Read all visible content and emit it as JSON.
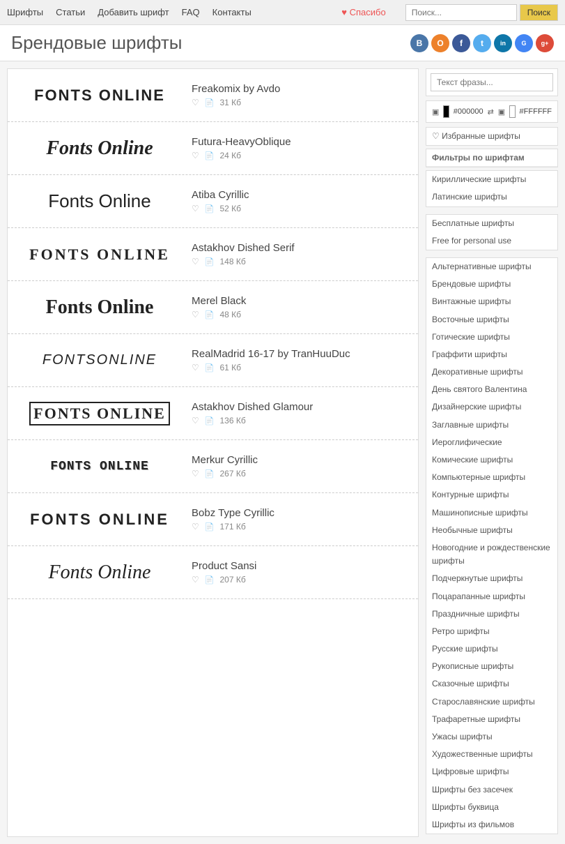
{
  "nav": {
    "links": [
      {
        "label": "Шрифты",
        "id": "nav-fonts"
      },
      {
        "label": "Статьи",
        "id": "nav-articles"
      },
      {
        "label": "Добавить шрифт",
        "id": "nav-add"
      },
      {
        "label": "FAQ",
        "id": "nav-faq"
      },
      {
        "label": "Контакты",
        "id": "nav-contacts"
      }
    ],
    "thanks": "♥ Спасибо",
    "search_placeholder": "Поиск...",
    "search_button": "Поиск"
  },
  "header": {
    "title": "Брендовые шрифты"
  },
  "social": [
    {
      "label": "В",
      "color": "#4a76a8",
      "id": "vk"
    },
    {
      "label": "О",
      "color": "#ed812b",
      "id": "ok"
    },
    {
      "label": "f",
      "color": "#3b5998",
      "id": "fb"
    },
    {
      "label": "t",
      "color": "#55acee",
      "id": "tw"
    },
    {
      "label": "in",
      "color": "#0e76a8",
      "id": "li"
    },
    {
      "label": "🔵",
      "color": "#4285f4",
      "id": "g1"
    },
    {
      "label": "g+",
      "color": "#dd4b39",
      "id": "gp"
    }
  ],
  "sidebar": {
    "phrase_placeholder": "Текст фразы...",
    "color_dark": "#000000",
    "color_light": "#FFFFFF",
    "favorites": "♡ Избранные шрифты",
    "filter_header": "Фильтры по шрифтам",
    "script_filters": [
      "Кириллические шрифты",
      "Латинские шрифты"
    ],
    "price_filters": [
      "Бесплатные шрифты",
      "Free for personal use"
    ],
    "category_filters": [
      "Альтернативные шрифты",
      "Брендовые шрифты",
      "Винтажные шрифты",
      "Восточные шрифты",
      "Готические шрифты",
      "Граффити шрифты",
      "Декоративные шрифты",
      "День святого Валентина",
      "Дизайнерские шрифты",
      "Заглавные шрифты",
      "Иероглифические",
      "Комические шрифты",
      "Компьютерные шрифты",
      "Контурные шрифты",
      "Машинописные шрифты",
      "Необычные шрифты",
      "Новогодние и рождественские шрифты",
      "Подчеркнутые шрифты",
      "Поцарапанные шрифты",
      "Праздничные шрифты",
      "Ретро шрифты",
      "Русские шрифты",
      "Рукописные шрифты",
      "Сказочные шрифты",
      "Старославянские шрифты",
      "Трафаретные шрифты",
      "Ужасы шрифты",
      "Художественные шрифты",
      "Цифровые шрифты",
      "Шрифты без засечек",
      "Шрифты буквица",
      "Шрифты из фильмов"
    ]
  },
  "fonts": [
    {
      "id": "freakomix",
      "name": "Freakomix by Avdo",
      "heart": "♡",
      "size": "31 Кб",
      "preview_text": "FONTS ONLINE",
      "preview_class": "preview-freakomix"
    },
    {
      "id": "futura",
      "name": "Futura-HeavyOblique",
      "heart": "♡",
      "size": "24 Кб",
      "preview_text": "Fonts Online",
      "preview_class": "preview-futura"
    },
    {
      "id": "atiba",
      "name": "Atiba Cyrillic",
      "heart": "♡",
      "size": "52 Кб",
      "preview_text": "Fonts Online",
      "preview_class": "preview-atiba"
    },
    {
      "id": "astakhov-serif",
      "name": "Astakhov Dished Serif",
      "heart": "♡",
      "size": "148 Кб",
      "preview_text": "FONTS ONLINE",
      "preview_class": "preview-astakhov"
    },
    {
      "id": "merel",
      "name": "Merel Black",
      "heart": "♡",
      "size": "48 Кб",
      "preview_text": "Fonts Online",
      "preview_class": "preview-merel"
    },
    {
      "id": "realmadrid",
      "name": "RealMadrid 16-17 by TranHuuDuc",
      "heart": "♡",
      "size": "61 Кб",
      "preview_text": "FONTSONLiNE",
      "preview_class": "preview-real"
    },
    {
      "id": "astakhov-glamour",
      "name": "Astakhov Dished Glamour",
      "heart": "♡",
      "size": "136 Кб",
      "preview_text": "FONTS ONLINE",
      "preview_class": "preview-glamour"
    },
    {
      "id": "merkur",
      "name": "Merkur Cyrillic",
      "heart": "♡",
      "size": "267 Кб",
      "preview_text": "FONTS ONLINE",
      "preview_class": "preview-merkur"
    },
    {
      "id": "bobz",
      "name": "Bobz Type Cyrillic",
      "heart": "♡",
      "size": "171 Кб",
      "preview_text": "FONTS ONLINE",
      "preview_class": "preview-bobz"
    },
    {
      "id": "product",
      "name": "Product Sansi",
      "heart": "♡",
      "size": "207 Кб",
      "preview_text": "Fonts Online",
      "preview_class": "preview-product"
    }
  ]
}
